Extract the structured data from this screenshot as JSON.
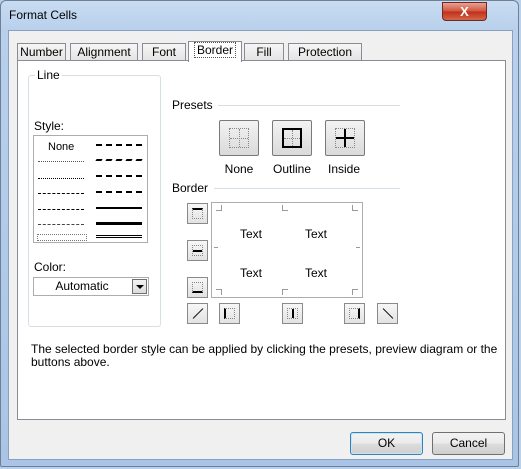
{
  "window": {
    "title": "Format Cells",
    "close_glyph": "X"
  },
  "tabs": [
    {
      "label": "Number"
    },
    {
      "label": "Alignment"
    },
    {
      "label": "Font"
    },
    {
      "label": "Border",
      "active": true
    },
    {
      "label": "Fill"
    },
    {
      "label": "Protection"
    }
  ],
  "line": {
    "group_label": "Line",
    "style_label": "Style:",
    "none_label": "None",
    "color_label": "Color:",
    "color_value": "Automatic"
  },
  "presets": {
    "group_label": "Presets",
    "items": [
      {
        "label": "None"
      },
      {
        "label": "Outline"
      },
      {
        "label": "Inside"
      }
    ]
  },
  "border": {
    "group_label": "Border",
    "preview_texts": [
      "Text",
      "Text",
      "Text",
      "Text"
    ]
  },
  "description": "The selected border style can be applied by clicking the presets, preview diagram or the buttons above.",
  "buttons": {
    "ok": "OK",
    "cancel": "Cancel"
  },
  "colors": {
    "titlebar": "#b8d0ec",
    "close": "#c8412a",
    "panel": "#ffffff"
  }
}
